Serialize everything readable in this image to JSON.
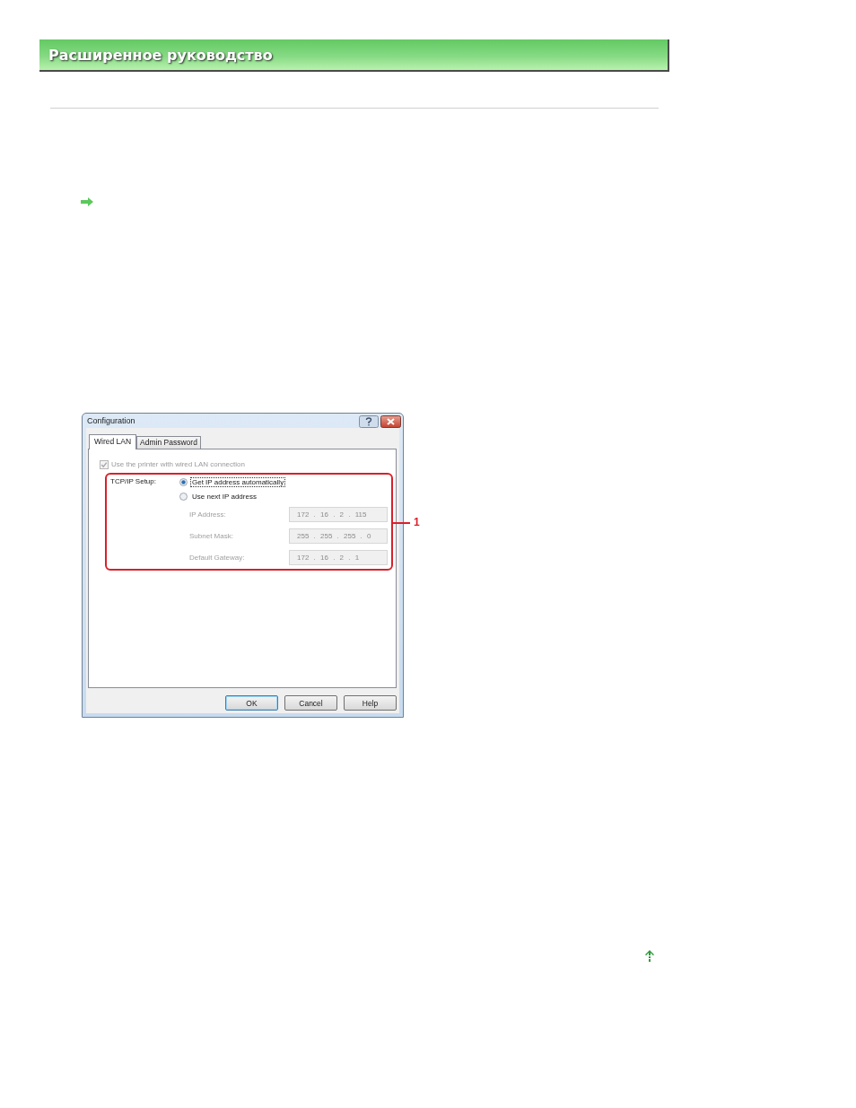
{
  "header": {
    "title": "Расширенное руководство"
  },
  "dialog": {
    "title": "Configuration",
    "tabs": [
      {
        "label": "Wired LAN",
        "selected": true
      },
      {
        "label": "Admin Password",
        "selected": false
      }
    ],
    "wired_lan_checkbox": {
      "label": "Use the printer with wired LAN connection",
      "checked": true,
      "disabled": true
    },
    "tcpip_setup": {
      "label": "TCP/IP Setup:",
      "options": [
        {
          "label": "Get IP address automatically",
          "selected": true,
          "focused": true
        },
        {
          "label": "Use next IP address",
          "selected": false,
          "focused": false
        }
      ],
      "fields": [
        {
          "label": "IP Address:",
          "value": "172 . 16 . 2 . 115",
          "disabled": true
        },
        {
          "label": "Subnet Mask:",
          "value": "255 . 255 . 255 . 0",
          "disabled": true
        },
        {
          "label": "Default Gateway:",
          "value": "172 . 16 . 2 . 1",
          "disabled": true
        }
      ]
    },
    "buttons": [
      {
        "label": "OK",
        "default": true
      },
      {
        "label": "Cancel",
        "default": false
      },
      {
        "label": "Help",
        "default": false
      }
    ]
  },
  "callout": {
    "label": "1"
  }
}
